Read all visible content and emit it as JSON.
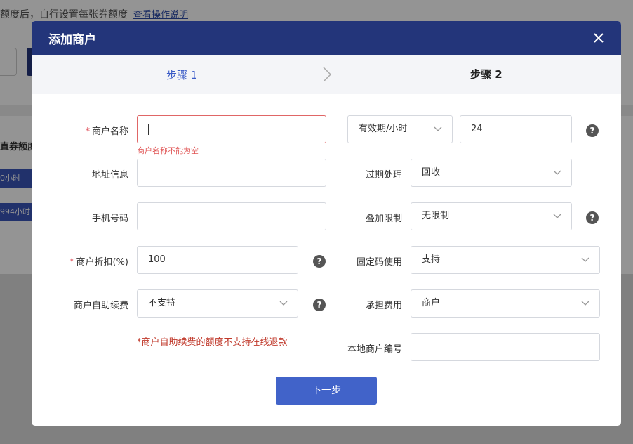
{
  "background": {
    "top_text": "额度后，自行设置每张券额度",
    "top_link": "查看操作说明",
    "table_header": "直券额度",
    "tag1": "0小时",
    "tag2": "994小时"
  },
  "modal": {
    "title": "添加商户",
    "close_label": "×",
    "step1": "步骤 1",
    "step2": "步骤 2"
  },
  "left": {
    "name_label": "商户名称",
    "name_value": "",
    "name_error": "商户名称不能为空",
    "address_label": "地址信息",
    "address_value": "",
    "phone_label": "手机号码",
    "phone_value": "",
    "discount_label": "商户折扣(%)",
    "discount_value": "100",
    "renew_label": "商户自助续费",
    "renew_value": "不支持",
    "renew_note": "*商户自助续费的额度不支持在线退款"
  },
  "right": {
    "validity_select": "有效期/小时",
    "validity_value": "24",
    "expire_label": "过期处理",
    "expire_value": "回收",
    "stack_label": "叠加限制",
    "stack_value": "无限制",
    "fixed_label": "固定码使用",
    "fixed_value": "支持",
    "fee_label": "承担费用",
    "fee_value": "商户",
    "local_label": "本地商户编号",
    "local_value": ""
  },
  "actions": {
    "next_label": "下一步"
  },
  "colors": {
    "header_bg": "#23357a",
    "primary": "#4163c9",
    "error": "#e05555"
  }
}
